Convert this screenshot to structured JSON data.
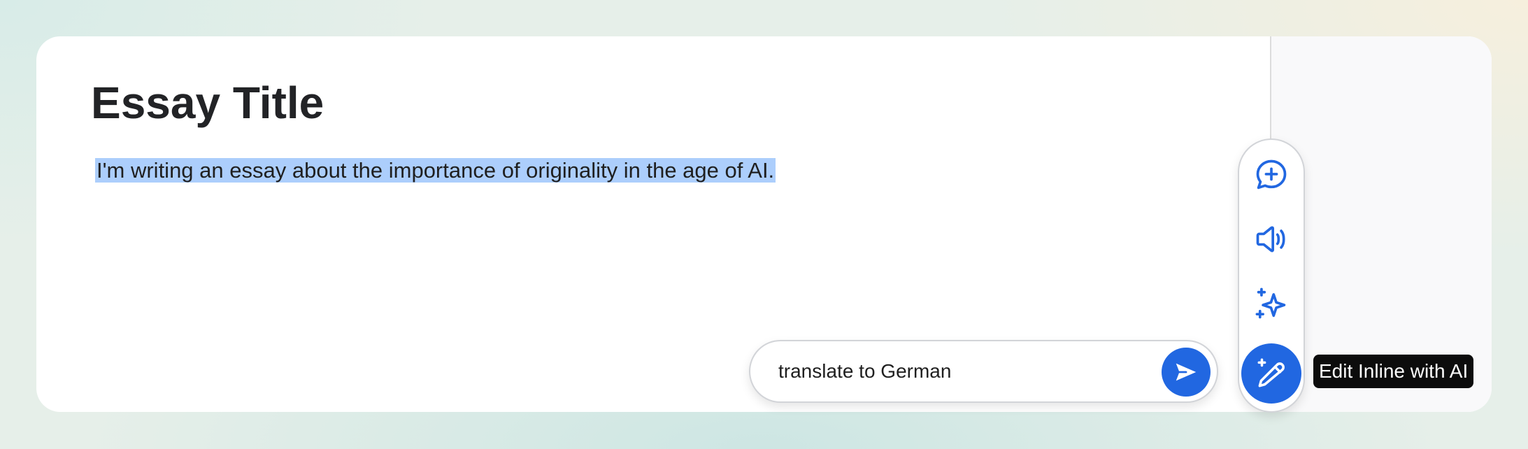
{
  "document": {
    "title": "Essay Title",
    "body": "I'm writing an essay about the importance of originality in the age of AI."
  },
  "toolbar": {
    "items": [
      {
        "icon": "comment-add-icon",
        "label": "Add comment"
      },
      {
        "icon": "speaker-icon",
        "label": "Read aloud"
      },
      {
        "icon": "sparkles-icon",
        "label": "AI suggestions"
      },
      {
        "icon": "magic-pencil-icon",
        "label": "Edit Inline with AI",
        "active": true
      }
    ],
    "tooltip": "Edit Inline with AI"
  },
  "prompt": {
    "value": "translate to German",
    "send_icon": "send-icon"
  },
  "colors": {
    "accent": "#2167e1",
    "selection": "#accefc",
    "tooltip_bg": "#0c0c0c",
    "title_text": "#222326"
  }
}
